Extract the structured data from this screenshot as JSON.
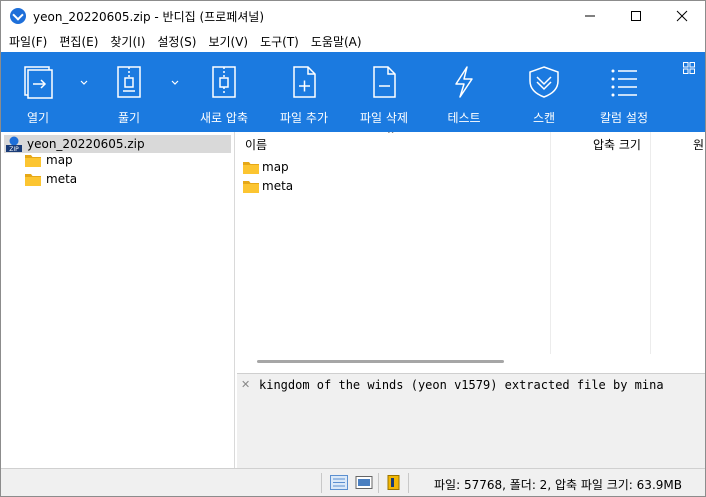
{
  "window": {
    "title": "yeon_20220605.zip - 반디집 (프로페셔널)",
    "controls": [
      "minimize-icon",
      "maximize-icon",
      "close-icon"
    ]
  },
  "menu": [
    {
      "label": "파일(F)"
    },
    {
      "label": "편집(E)"
    },
    {
      "label": "찾기(I)"
    },
    {
      "label": "설정(S)"
    },
    {
      "label": "보기(V)"
    },
    {
      "label": "도구(T)"
    },
    {
      "label": "도움말(A)"
    }
  ],
  "toolbar": {
    "open": {
      "label": "열기",
      "icon": "open-archive-icon"
    },
    "extract": {
      "label": "풀기",
      "icon": "extract-icon"
    },
    "new_archive": {
      "label": "새로 압축",
      "icon": "new-archive-icon"
    },
    "add_file": {
      "label": "파일 추가",
      "icon": "add-file-icon"
    },
    "delete_file": {
      "label": "파일 삭제",
      "icon": "delete-file-icon"
    },
    "test": {
      "label": "테스트",
      "icon": "lightning-icon"
    },
    "scan": {
      "label": "스캔",
      "icon": "shield-icon"
    },
    "columns": {
      "label": "칼럼 설정",
      "icon": "list-icon"
    },
    "accent": "#1b7ae0"
  },
  "tree": {
    "root": "yeon_20220605.zip",
    "items": [
      "map",
      "meta"
    ]
  },
  "list": {
    "columns": {
      "name": "이름",
      "packed": "압축 크기",
      "original": "원"
    },
    "rows": [
      "map",
      "meta"
    ]
  },
  "comment": "kingdom of the winds (yeon v1579) extracted file by mina",
  "status": {
    "text": "파일: 57768, 폴더: 2, 압축 파일 크기: 63.9MB"
  }
}
